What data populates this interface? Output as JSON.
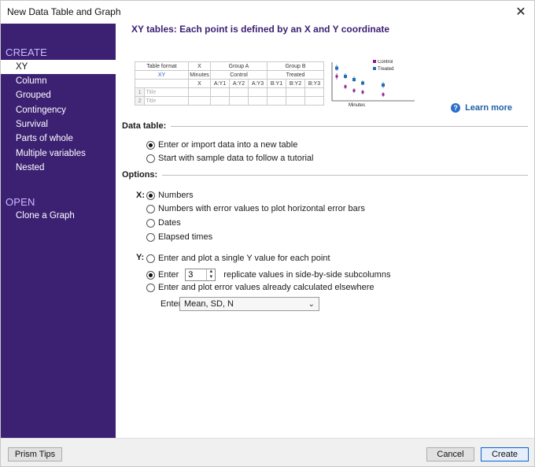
{
  "window": {
    "title": "New Data Table and Graph",
    "close_glyph": "✕"
  },
  "sidebar": {
    "create_heading": "CREATE",
    "create_items": [
      "XY",
      "Column",
      "Grouped",
      "Contingency",
      "Survival",
      "Parts of whole",
      "Multiple variables",
      "Nested"
    ],
    "selected_item": "XY",
    "open_heading": "OPEN",
    "open_items": [
      "Clone a Graph"
    ]
  },
  "main": {
    "heading": "XY tables: Each point is defined by an X and Y coordinate",
    "learn_more": "Learn more",
    "help_glyph": "?"
  },
  "preview_table": {
    "format_label": "Table format",
    "format_value": "XY",
    "x_label": "X",
    "group_a": "Group A",
    "group_b": "Group B",
    "x_sub": "Minutes",
    "control": "Control",
    "treated": "Treated",
    "col_x": "X",
    "cols_a": [
      "A:Y1",
      "A:Y2",
      "A:Y3"
    ],
    "cols_b": [
      "B:Y1",
      "B:Y2",
      "B:Y3"
    ],
    "rows": [
      {
        "num": "1",
        "title": "Title"
      },
      {
        "num": "2",
        "title": "Title"
      }
    ]
  },
  "mini_chart": {
    "legend": [
      {
        "name": "Control",
        "color": "#8b1a8b"
      },
      {
        "name": "Treated",
        "color": "#1f6fb5"
      }
    ],
    "xlabel": "Minutes"
  },
  "data_table": {
    "label": "Data table:",
    "options": [
      {
        "text": "Enter or import data into a new table",
        "selected": true
      },
      {
        "text": "Start with sample data to follow a tutorial",
        "selected": false
      }
    ]
  },
  "options_section": {
    "label": "Options:"
  },
  "x_options": {
    "label": "X:",
    "options": [
      {
        "text": "Numbers",
        "selected": true
      },
      {
        "text": "Numbers with error values to plot horizontal error bars",
        "selected": false
      },
      {
        "text": "Dates",
        "selected": false
      },
      {
        "text": "Elapsed times",
        "selected": false
      }
    ]
  },
  "y_options": {
    "label": "Y:",
    "single": {
      "text": "Enter and plot a single Y value for each point",
      "selected": false
    },
    "replicate": {
      "prefix": "Enter",
      "value": "3",
      "suffix": "replicate values in side-by-side subcolumns",
      "selected": true
    },
    "error": {
      "text": "Enter and plot error values already calculated elsewhere",
      "selected": false
    },
    "enter_label": "Enter:",
    "enter_value": "Mean, SD, N"
  },
  "footer": {
    "tips": "Prism Tips",
    "cancel": "Cancel",
    "create": "Create"
  }
}
